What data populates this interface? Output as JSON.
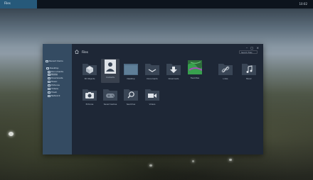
{
  "taskbar": {
    "start_label": "Files",
    "clock": "10:02"
  },
  "window": {
    "title": "Files",
    "search_placeholder": "Search Files",
    "sidebar": [
      {
        "label": "Recent items",
        "icon": "clock-icon"
      },
      {
        "label": "Desktop",
        "icon": "desktop-icon"
      },
      {
        "label": "Documents",
        "icon": "document-icon"
      },
      {
        "label": "Home",
        "icon": "home-icon",
        "active": true
      },
      {
        "label": "Downloads",
        "icon": "download-icon"
      },
      {
        "label": "Music",
        "icon": "music-icon"
      },
      {
        "label": "Pictures",
        "icon": "picture-icon"
      },
      {
        "label": "Videos",
        "icon": "video-icon"
      },
      {
        "label": "Trash",
        "icon": "trash-icon"
      },
      {
        "label": "Network",
        "icon": "network-icon"
      }
    ],
    "items": [
      {
        "label": "3D Objects",
        "icon": "box-icon"
      },
      {
        "label": "Contacts",
        "icon": "contacts-icon",
        "selected": true
      },
      {
        "label": "Desktop",
        "icon": "desktop-icon"
      },
      {
        "label": "Documents",
        "icon": "folder-icon"
      },
      {
        "label": "Downloads",
        "icon": "download-icon"
      },
      {
        "label": "Favorites",
        "icon": "map-icon"
      },
      {
        "label": "Links",
        "icon": "link-icon"
      },
      {
        "label": "Music",
        "icon": "music-icon"
      },
      {
        "label": "Pictures",
        "icon": "camera-icon"
      },
      {
        "label": "Saved Games",
        "icon": "gamepad-icon"
      },
      {
        "label": "Searches",
        "icon": "search-icon"
      },
      {
        "label": "Videos",
        "icon": "video-icon"
      }
    ]
  }
}
